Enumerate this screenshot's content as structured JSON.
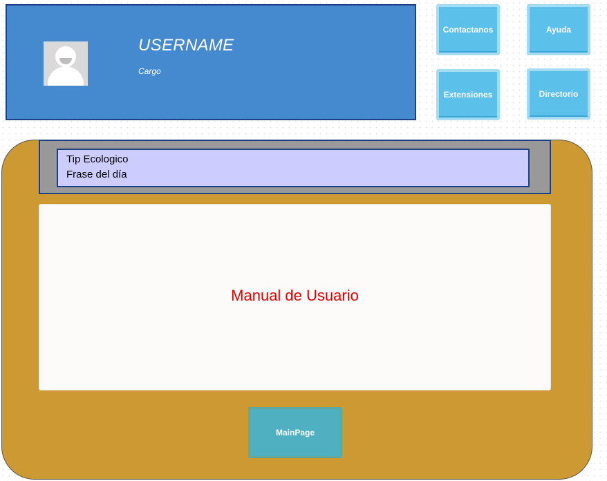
{
  "profile": {
    "username": "USERNAME",
    "role": "Cargo"
  },
  "tiles": {
    "contact": "Contactanos",
    "help": "Ayuda",
    "extensions": "Extensiones",
    "directory": "Directorio"
  },
  "tips": {
    "eco_tip": "Tip Ecologico",
    "daily_phrase": "Frase del día"
  },
  "content": {
    "title": "Manual de Usuario"
  },
  "footer": {
    "main_page_button": "MainPage"
  },
  "colors": {
    "profile_bg": "#4589cf",
    "tile_bg": "#5bc0ea",
    "panel_bg": "#cc9933",
    "tip_bg": "#ccccff",
    "manual_text": "#e00000",
    "main_button_bg": "#4fb0c1"
  }
}
